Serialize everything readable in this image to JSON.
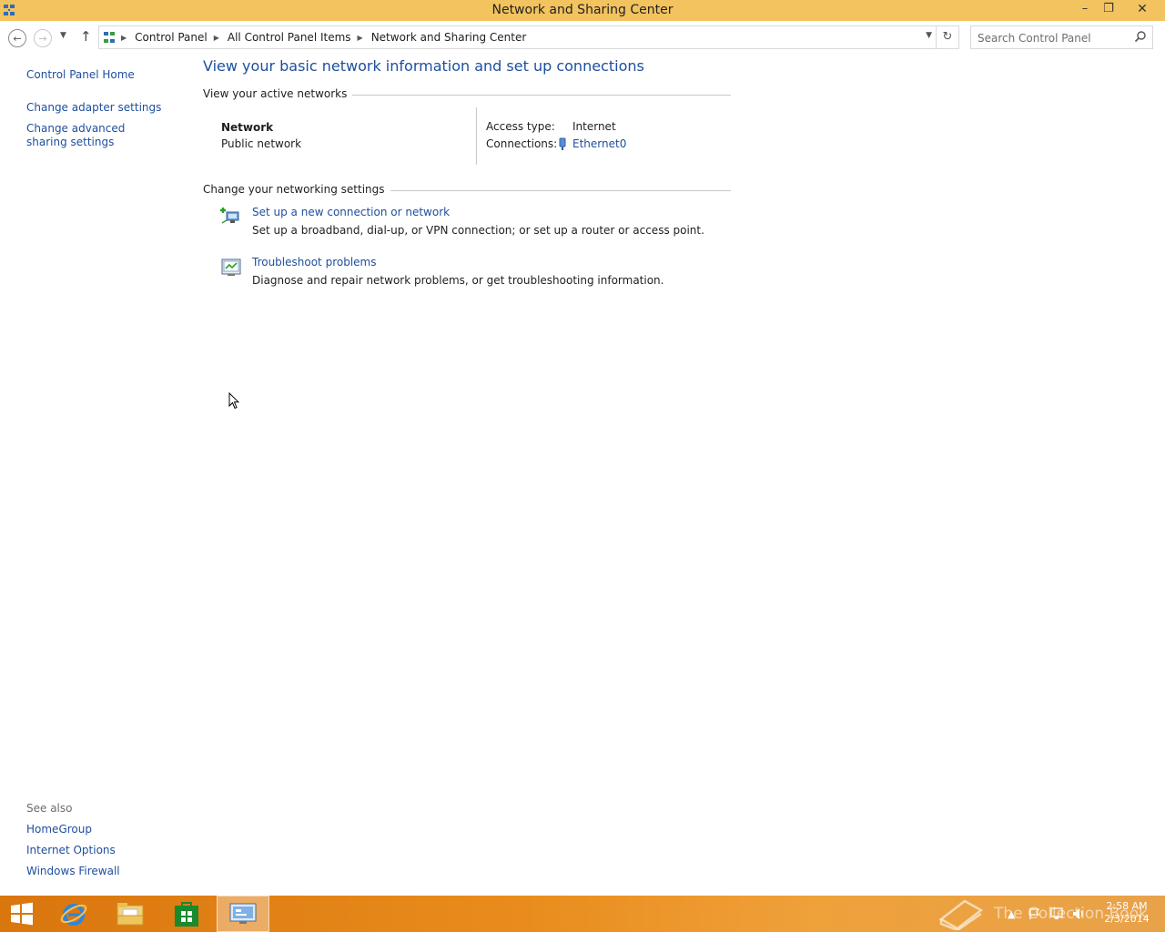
{
  "window": {
    "title": "Network and Sharing Center",
    "minimize": "–",
    "maximize": "❐",
    "close": "✕"
  },
  "navigation": {
    "breadcrumbs": [
      "Control Panel",
      "All Control Panel Items",
      "Network and Sharing Center"
    ],
    "search_placeholder": "Search Control Panel"
  },
  "sidebar": {
    "home": "Control Panel Home",
    "links": [
      "Change adapter settings",
      "Change advanced sharing settings"
    ],
    "see_also_label": "See also",
    "see_also": [
      "HomeGroup",
      "Internet Options",
      "Windows Firewall"
    ]
  },
  "main": {
    "title": "View your basic network information and set up connections",
    "active_networks_heading": "View your active networks",
    "network": {
      "name": "Network",
      "type": "Public network",
      "access_type_label": "Access type:",
      "access_type_value": "Internet",
      "connections_label": "Connections:",
      "connection_name": "Ethernet0"
    },
    "settings_heading": "Change your networking settings",
    "tasks": [
      {
        "title": "Set up a new connection or network",
        "description": "Set up a broadband, dial-up, or VPN connection; or set up a router or access point.",
        "icon": "new-connection-icon"
      },
      {
        "title": "Troubleshoot problems",
        "description": "Diagnose and repair network problems, or get troubleshooting information.",
        "icon": "troubleshoot-icon"
      }
    ]
  },
  "taskbar": {
    "apps": [
      "start-icon",
      "internet-explorer-icon",
      "file-explorer-icon",
      "store-icon",
      "control-panel-icon"
    ],
    "time": "2:58 AM",
    "date": "2/3/2014",
    "watermark": "The Collection Book"
  },
  "colors": {
    "titlebar": "#f2c35e",
    "link": "#1e4e9e",
    "taskbar": "#e98c1d"
  }
}
